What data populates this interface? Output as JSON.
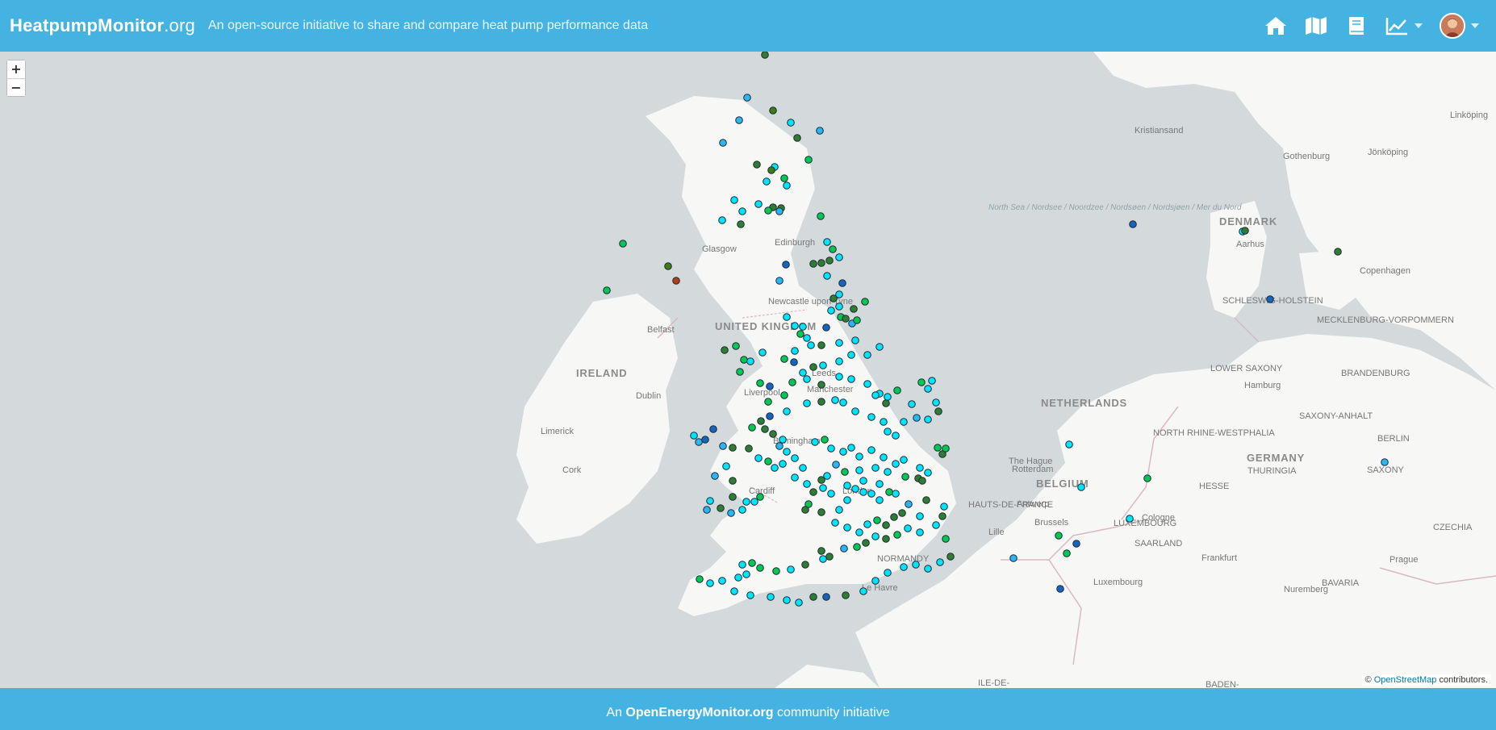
{
  "header": {
    "brand_bold": "HeatpumpMonitor",
    "brand_suffix": ".org",
    "tagline": "An open-source initiative to share and compare heat pump performance data",
    "nav": [
      {
        "name": "home-icon"
      },
      {
        "name": "map-icon"
      },
      {
        "name": "book-icon"
      },
      {
        "name": "chart-line-icon"
      }
    ]
  },
  "map": {
    "zoom_in": "+",
    "zoom_out": "−",
    "attribution_prefix": "©",
    "attribution_link": "OpenStreetMap",
    "attribution_suffix": "contributors.",
    "colors": {
      "sea": "#d4dadc",
      "land": "#f7f7f6",
      "border": "#d9b8c6",
      "river": "#cfd8dc"
    },
    "labels": {
      "uk": "UNITED KINGDOM",
      "ireland": "IRELAND",
      "netherlands": "NETHERLANDS",
      "belgium": "BELGIUM",
      "germany": "GERMANY",
      "denmark": "DENMARK",
      "luxembourg": "LUXEMBOURG",
      "normandy": "NORMANDY",
      "hauts_de_france": "HAUTS-DE-FRANCE",
      "north_sea": "North Sea / Nordsee / Noordzee / Nordsøen / Nordsjøen / Mer du Nord",
      "schleswig": "SCHLESWIG-HOLSTEIN",
      "mecklenburg": "MECKLENBURG-VORPOMMERN",
      "lower_saxony": "LOWER SAXONY",
      "brandenburg": "BRANDENBURG",
      "saxony_anhalt": "SAXONY-ANHALT",
      "nrw": "NORTH RHINE-WESTPHALIA",
      "thuringia": "THURINGIA",
      "saxony": "SAXONY",
      "hesse": "HESSE",
      "saarland": "SAARLAND",
      "bavaria": "BAVARIA",
      "czechia": "CZECHIA",
      "baden": "BADEN-",
      "ile_de_france": "ILE-DE-"
    },
    "cities": {
      "glasgow": "Glasgow",
      "edinburgh": "Edinburgh",
      "newcastle": "Newcastle upon Tyne",
      "belfast": "Belfast",
      "dublin": "Dublin",
      "limerick": "Limerick",
      "cork": "Cork",
      "liverpool": "Liverpool",
      "manchester": "Manchester",
      "leeds": "Leeds",
      "birmingham": "Birmingham",
      "cardiff": "Cardiff",
      "london": "London",
      "le_havre": "Le Havre",
      "lille": "Lille",
      "brussels": "Brussels",
      "antwerp": "Antwerp",
      "the_hague": "The Hague",
      "rotterdam": "Rotterdam",
      "cologne": "Cologne",
      "luxembourg_city": "Luxembourg",
      "frankfurt": "Frankfurt",
      "nuremberg": "Nuremberg",
      "prague": "Prague",
      "berlin": "BERLIN",
      "hamburg": "Hamburg",
      "copenhagen": "Copenhagen",
      "aarhus": "Aarhus",
      "gothenburg": "Gothenburg",
      "jonkoping": "Jönköping",
      "linkoping": "Linköping",
      "kristiansand": "Kristiansand"
    }
  },
  "footer": {
    "prefix": "An",
    "link": "OpenEnergyMonitor.org",
    "suffix": "community initiative"
  }
}
